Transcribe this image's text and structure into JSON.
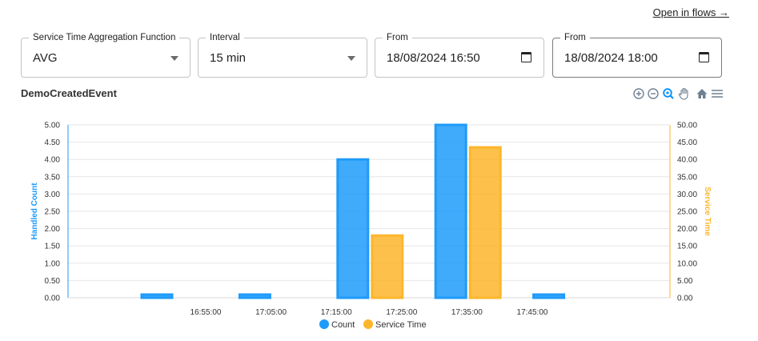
{
  "header": {
    "flows_link": "Open in flows →"
  },
  "filters": {
    "aggregation": {
      "label": "Service Time Aggregation Function",
      "value": "AVG"
    },
    "interval": {
      "label": "Interval",
      "value": "15 min"
    },
    "from1": {
      "label": "From",
      "value": "18/08/2024  16:50"
    },
    "from2": {
      "label": "From",
      "value": "18/08/2024  18:00"
    }
  },
  "chart_title": "DemoCreatedEvent",
  "toolbar": {
    "icons": [
      "zoom-in-icon",
      "zoom-out-icon",
      "zoom-selection-icon",
      "pan-hand-icon",
      "home-reset-icon",
      "menu-icon"
    ]
  },
  "chart_data": {
    "type": "bar",
    "x_type": "datetime",
    "x_ticks": [
      "16:55:00",
      "17:05:00",
      "17:15:00",
      "17:25:00",
      "17:35:00",
      "17:45:00"
    ],
    "categories": [
      "16:45",
      "17:00",
      "17:15",
      "17:30",
      "17:45"
    ],
    "series": [
      {
        "name": "Count",
        "axis": "left",
        "color": "#1e9bfa",
        "values": [
          0,
          0,
          4,
          5,
          0
        ]
      },
      {
        "name": "Service Time",
        "axis": "right",
        "color": "#fdb62c",
        "values": [
          0,
          0,
          18,
          43.5,
          0
        ]
      }
    ],
    "y_left": {
      "title": "Handled Count",
      "color": "#1e9bfa",
      "ylim": [
        0,
        5
      ],
      "ticks": [
        "0.00",
        "0.50",
        "1.00",
        "1.50",
        "2.00",
        "2.50",
        "3.00",
        "3.50",
        "4.00",
        "4.50",
        "5.00"
      ]
    },
    "y_right": {
      "title": "Service Time",
      "color": "#fdb62c",
      "ylim": [
        0,
        50
      ],
      "ticks": [
        "0.00",
        "5.00",
        "10.00",
        "15.00",
        "20.00",
        "25.00",
        "30.00",
        "35.00",
        "40.00",
        "45.00",
        "50.00"
      ]
    },
    "grid": true,
    "legend_position": "bottom-center"
  }
}
